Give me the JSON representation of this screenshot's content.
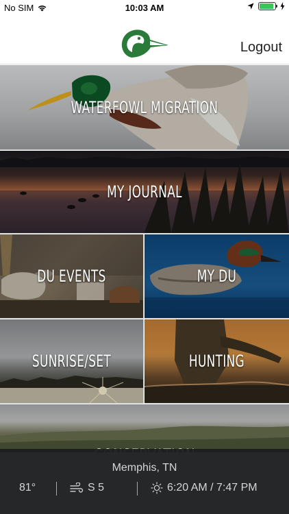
{
  "status_bar": {
    "carrier": "No SIM",
    "time": "10:03 AM"
  },
  "header": {
    "logout_label": "Logout"
  },
  "tiles": {
    "migration": "WATERFOWL MIGRATION",
    "journal": "MY JOURNAL",
    "events": "DU EVENTS",
    "mydu": "MY DU",
    "sunrise": "SUNRISE/SET",
    "hunting": "HUNTING",
    "conservation": "CONSERVATION"
  },
  "weather": {
    "city": "Memphis, TN",
    "temperature": "81°",
    "wind": "S 5",
    "sun_times": "6:20 AM / 7:47 PM"
  },
  "colors": {
    "logo_green": "#2a7a3a",
    "battery_green": "#34c759",
    "weather_bg": "#1c1e20"
  }
}
